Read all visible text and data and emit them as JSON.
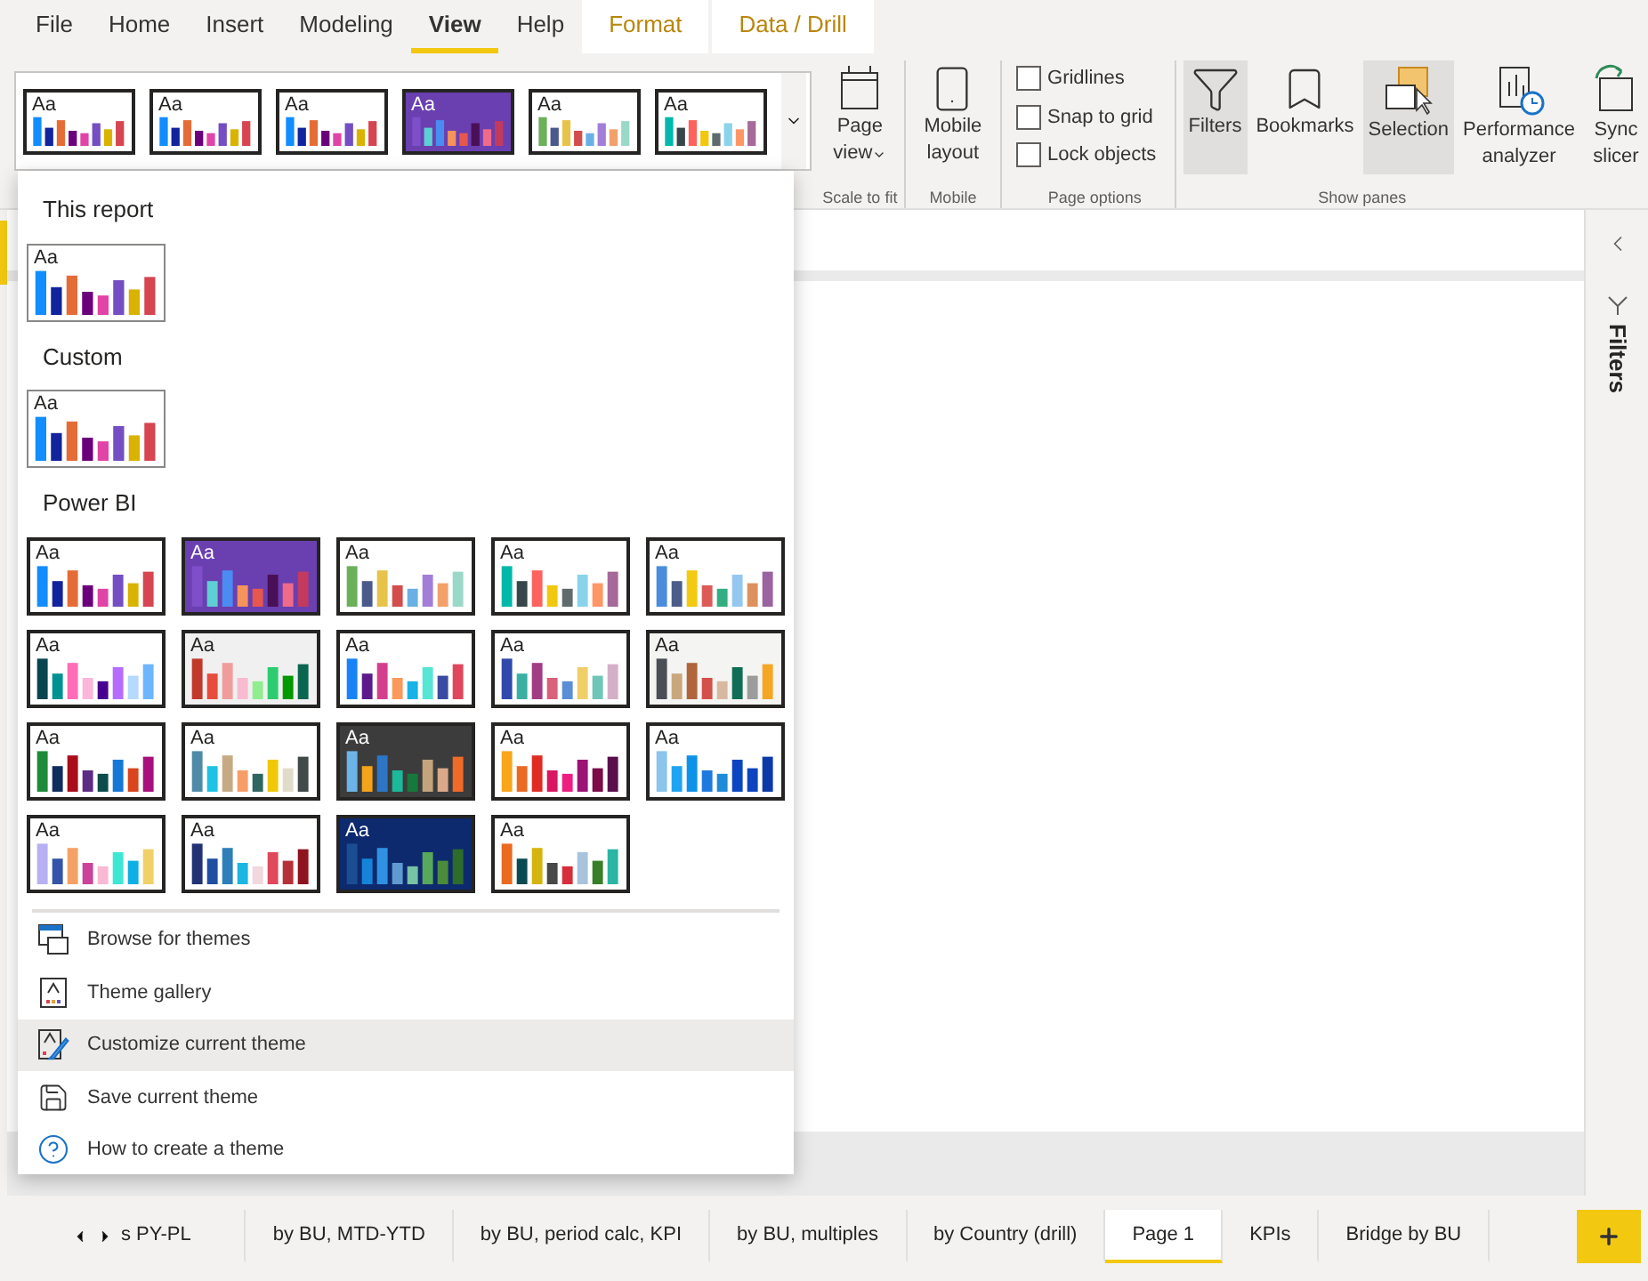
{
  "menu_tabs": [
    {
      "label": "File",
      "kind": "plain",
      "selected": false
    },
    {
      "label": "Home",
      "kind": "plain",
      "selected": false
    },
    {
      "label": "Insert",
      "kind": "plain",
      "selected": false
    },
    {
      "label": "Modeling",
      "kind": "plain",
      "selected": false
    },
    {
      "label": "View",
      "kind": "plain",
      "selected": true
    },
    {
      "label": "Help",
      "kind": "plain",
      "selected": false
    },
    {
      "label": "Format",
      "kind": "contextual",
      "selected": false
    },
    {
      "label": "Data / Drill",
      "kind": "contextual",
      "selected": false
    }
  ],
  "ribbon": {
    "theme_strip": [
      {
        "label": "Aa",
        "color": "#ffffff",
        "bars": [
          {
            "color": "#118dff"
          },
          {
            "color": "#12239e"
          },
          {
            "color": "#e66c37"
          },
          {
            "color": "#6b007b"
          },
          {
            "color": "#e044a7"
          },
          {
            "color": "#744ec2"
          },
          {
            "color": "#d9b300"
          },
          {
            "color": "#d64550"
          }
        ]
      },
      {
        "label": "Aa",
        "color": "#ffffff",
        "bars": [
          {
            "color": "#118dff"
          },
          {
            "color": "#12239e"
          },
          {
            "color": "#e66c37"
          },
          {
            "color": "#6b007b"
          },
          {
            "color": "#e044a7"
          },
          {
            "color": "#744ec2"
          },
          {
            "color": "#d9b300"
          },
          {
            "color": "#d64550"
          }
        ]
      },
      {
        "label": "Aa",
        "color": "#ffffff",
        "bars": [
          {
            "color": "#118dff"
          },
          {
            "color": "#12239e"
          },
          {
            "color": "#e66c37"
          },
          {
            "color": "#6b007b"
          },
          {
            "color": "#e044a7"
          },
          {
            "color": "#744ec2"
          },
          {
            "color": "#d9b300"
          },
          {
            "color": "#d64550"
          }
        ]
      },
      {
        "label": "Aa",
        "color": "#6a3fb0",
        "bars": [
          {
            "color": "#7e4fc8"
          },
          {
            "color": "#5ecfd3"
          },
          {
            "color": "#4a8cf2"
          },
          {
            "color": "#f4935a"
          },
          {
            "color": "#e8574d"
          },
          {
            "color": "#4a1057"
          },
          {
            "color": "#f06a8a"
          },
          {
            "color": "#c33a5f"
          }
        ]
      },
      {
        "label": "Aa",
        "color": "#ffffff",
        "bars": [
          {
            "color": "#6cb05a"
          },
          {
            "color": "#4b5a8a"
          },
          {
            "color": "#e8c34a"
          },
          {
            "color": "#d34d4d"
          },
          {
            "color": "#6ab0e4"
          },
          {
            "color": "#a37ed8"
          },
          {
            "color": "#f3a16b"
          },
          {
            "color": "#9ad9c8"
          }
        ]
      },
      {
        "label": "Aa",
        "color": "#ffffff",
        "bars": [
          {
            "color": "#01b8aa"
          },
          {
            "color": "#374649"
          },
          {
            "color": "#fd625e"
          },
          {
            "color": "#f2c80f"
          },
          {
            "color": "#5f6b6d"
          },
          {
            "color": "#8ad4eb"
          },
          {
            "color": "#fe9666"
          },
          {
            "color": "#a66999"
          }
        ]
      }
    ],
    "page_view": {
      "lines": [
        "Page",
        "view"
      ],
      "group": "Scale to fit"
    },
    "mobile_layout": {
      "lines": [
        "Mobile",
        "layout"
      ],
      "group": "Mobile"
    },
    "page_options": {
      "group": "Page options",
      "checkboxes": [
        {
          "label": "Gridlines",
          "checked": false
        },
        {
          "label": "Snap to grid",
          "checked": false
        },
        {
          "label": "Lock objects",
          "checked": false
        }
      ]
    },
    "show_panes": {
      "group": "Show panes",
      "buttons": [
        {
          "kind": "filters",
          "lines": [
            "Filters"
          ],
          "on": true
        },
        {
          "kind": "bookmarks",
          "lines": [
            "Bookmarks"
          ],
          "on": false
        },
        {
          "kind": "selection",
          "lines": [
            "Selection"
          ],
          "on": true
        },
        {
          "kind": "performance",
          "lines": [
            "Performance",
            "analyzer"
          ],
          "on": false
        },
        {
          "kind": "sync",
          "lines": [
            "Sync",
            "slicer"
          ],
          "on": false
        }
      ]
    }
  },
  "theme_menu": {
    "sections": [
      {
        "title": "This report",
        "themes": [
          {
            "label": "Aa",
            "color": "#ffffff",
            "bars": [
              {
                "color": "#118dff"
              },
              {
                "color": "#12239e"
              },
              {
                "color": "#e66c37"
              },
              {
                "color": "#6b007b"
              },
              {
                "color": "#e044a7"
              },
              {
                "color": "#744ec2"
              },
              {
                "color": "#d9b300"
              },
              {
                "color": "#d64550"
              }
            ]
          }
        ]
      },
      {
        "title": "Custom",
        "themes": [
          {
            "label": "Aa",
            "color": "#ffffff",
            "bars": [
              {
                "color": "#118dff"
              },
              {
                "color": "#12239e"
              },
              {
                "color": "#e66c37"
              },
              {
                "color": "#6b007b"
              },
              {
                "color": "#e044a7"
              },
              {
                "color": "#744ec2"
              },
              {
                "color": "#d9b300"
              },
              {
                "color": "#d64550"
              }
            ]
          }
        ]
      },
      {
        "title": "Power BI",
        "themes": [
          {
            "label": "Aa",
            "color": "#ffffff",
            "bars": [
              {
                "color": "#118dff"
              },
              {
                "color": "#12239e"
              },
              {
                "color": "#e66c37"
              },
              {
                "color": "#6b007b"
              },
              {
                "color": "#e044a7"
              },
              {
                "color": "#744ec2"
              },
              {
                "color": "#d9b300"
              },
              {
                "color": "#d64550"
              }
            ]
          },
          {
            "label": "Aa",
            "color": "#6a3fb0",
            "bars": [
              {
                "color": "#7e4fc8"
              },
              {
                "color": "#5ecfd3"
              },
              {
                "color": "#4a8cf2"
              },
              {
                "color": "#f4935a"
              },
              {
                "color": "#e8574d"
              },
              {
                "color": "#4a1057"
              },
              {
                "color": "#f06a8a"
              },
              {
                "color": "#c33a5f"
              }
            ]
          },
          {
            "label": "Aa",
            "color": "#ffffff",
            "bars": [
              {
                "color": "#6cb05a"
              },
              {
                "color": "#4b5a8a"
              },
              {
                "color": "#e8c34a"
              },
              {
                "color": "#d34d4d"
              },
              {
                "color": "#6ab0e4"
              },
              {
                "color": "#a37ed8"
              },
              {
                "color": "#f3a16b"
              },
              {
                "color": "#9ad9c8"
              }
            ]
          },
          {
            "label": "Aa",
            "color": "#ffffff",
            "bars": [
              {
                "color": "#01b8aa"
              },
              {
                "color": "#374649"
              },
              {
                "color": "#fd625e"
              },
              {
                "color": "#f2c80f"
              },
              {
                "color": "#5f6b6d"
              },
              {
                "color": "#8ad4eb"
              },
              {
                "color": "#fe9666"
              },
              {
                "color": "#a66999"
              }
            ]
          },
          {
            "label": "Aa",
            "color": "#ffffff",
            "bars": [
              {
                "color": "#4a8ddc"
              },
              {
                "color": "#4c5d8a"
              },
              {
                "color": "#f3c911"
              },
              {
                "color": "#dc5b57"
              },
              {
                "color": "#33ae81"
              },
              {
                "color": "#95c8f0"
              },
              {
                "color": "#dd915f"
              },
              {
                "color": "#9a64a0"
              }
            ]
          },
          {
            "label": "Aa",
            "color": "#ffffff",
            "bars": [
              {
                "color": "#074650"
              },
              {
                "color": "#009292"
              },
              {
                "color": "#fe6db6"
              },
              {
                "color": "#feb5da"
              },
              {
                "color": "#480091"
              },
              {
                "color": "#b66dff"
              },
              {
                "color": "#b5dafe"
              },
              {
                "color": "#6db6ff"
              }
            ]
          },
          {
            "label": "Aa",
            "color": "#f0f0f0",
            "bars": [
              {
                "color": "#c0392b"
              },
              {
                "color": "#e74c3c"
              },
              {
                "color": "#f19c9c"
              },
              {
                "color": "#f8bbd0"
              },
              {
                "color": "#90ee90"
              },
              {
                "color": "#2ecc71"
              },
              {
                "color": "#009900"
              },
              {
                "color": "#0b6650"
              }
            ]
          },
          {
            "label": "Aa",
            "color": "#ffffff",
            "bars": [
              {
                "color": "#1883f6"
              },
              {
                "color": "#5c1a8a"
              },
              {
                "color": "#d43f8d"
              },
              {
                "color": "#f99a5b"
              },
              {
                "color": "#17b2e6"
              },
              {
                "color": "#55e6d6"
              },
              {
                "color": "#3b4ba3"
              },
              {
                "color": "#e0475d"
              }
            ]
          },
          {
            "label": "Aa",
            "color": "#ffffff",
            "bars": [
              {
                "color": "#3049ad"
              },
              {
                "color": "#3ab0a3"
              },
              {
                "color": "#a23c83"
              },
              {
                "color": "#d9617a"
              },
              {
                "color": "#5b8ed6"
              },
              {
                "color": "#f0cf68"
              },
              {
                "color": "#6fc6b7"
              },
              {
                "color": "#d4afc8"
              }
            ]
          },
          {
            "label": "Aa",
            "color": "#f4f4f2",
            "bars": [
              {
                "color": "#4a4f55"
              },
              {
                "color": "#c9a77c"
              },
              {
                "color": "#b0653c"
              },
              {
                "color": "#d3514a"
              },
              {
                "color": "#d9b8a0"
              },
              {
                "color": "#0f6e55"
              },
              {
                "color": "#9c9c9c"
              },
              {
                "color": "#f5a623"
              }
            ]
          },
          {
            "label": "Aa",
            "color": "#ffffff",
            "bars": [
              {
                "color": "#1e8b3a"
              },
              {
                "color": "#0f2d5c"
              },
              {
                "color": "#a90d19"
              },
              {
                "color": "#5d2b84"
              },
              {
                "color": "#0d4c4c"
              },
              {
                "color": "#1578d6"
              },
              {
                "color": "#d9451e"
              },
              {
                "color": "#a80e7e"
              }
            ]
          },
          {
            "label": "Aa",
            "color": "#ffffff",
            "bars": [
              {
                "color": "#4f8ba8"
              },
              {
                "color": "#1ec3e3"
              },
              {
                "color": "#c6aa83"
              },
              {
                "color": "#f79e68"
              },
              {
                "color": "#2f6660"
              },
              {
                "color": "#f0c808"
              },
              {
                "color": "#e0dcca"
              },
              {
                "color": "#3f4a49"
              }
            ]
          },
          {
            "label": "Aa",
            "color": "#3c3c3c",
            "bars": [
              {
                "color": "#6cb4e8"
              },
              {
                "color": "#f4a31b"
              },
              {
                "color": "#2d76c6"
              },
              {
                "color": "#1bb89a"
              },
              {
                "color": "#17783d"
              },
              {
                "color": "#c4a47c"
              },
              {
                "color": "#d9a98a"
              },
              {
                "color": "#f06a28"
              }
            ]
          },
          {
            "label": "Aa",
            "color": "#ffffff",
            "bars": [
              {
                "color": "#f9a61a"
              },
              {
                "color": "#eb6a22"
              },
              {
                "color": "#e02d24"
              },
              {
                "color": "#d81760"
              },
              {
                "color": "#ef1d82"
              },
              {
                "color": "#9c1276"
              },
              {
                "color": "#7c0b46"
              },
              {
                "color": "#5b0e4c"
              }
            ]
          },
          {
            "label": "Aa",
            "color": "#ffffff",
            "bars": [
              {
                "color": "#8cc5ec"
              },
              {
                "color": "#1ea4f2"
              },
              {
                "color": "#0d92ea"
              },
              {
                "color": "#1f7ae0"
              },
              {
                "color": "#1d8bd7"
              },
              {
                "color": "#0a46c2"
              },
              {
                "color": "#0c44c0"
              },
              {
                "color": "#0b3aa8"
              }
            ]
          },
          {
            "label": "Aa",
            "color": "#ffffff",
            "bars": [
              {
                "color": "#b7b0f2"
              },
              {
                "color": "#3354a8"
              },
              {
                "color": "#f5a165"
              },
              {
                "color": "#c9449a"
              },
              {
                "color": "#f9b8d4"
              },
              {
                "color": "#3de7d4"
              },
              {
                "color": "#0db0e4"
              },
              {
                "color": "#f0d067"
              }
            ]
          },
          {
            "label": "Aa",
            "color": "#ffffff",
            "bars": [
              {
                "color": "#223275"
              },
              {
                "color": "#1e4fa1"
              },
              {
                "color": "#2e7fb9"
              },
              {
                "color": "#1bb6e2"
              },
              {
                "color": "#f2d7dd"
              },
              {
                "color": "#e0485b"
              },
              {
                "color": "#b5313a"
              },
              {
                "color": "#8f121f"
              }
            ]
          },
          {
            "label": "Aa",
            "color": "#0d2a6e",
            "bars": [
              {
                "color": "#1b4d93"
              },
              {
                "color": "#1584d8"
              },
              {
                "color": "#2f91e2"
              },
              {
                "color": "#5f9bd1"
              },
              {
                "color": "#78c2a5"
              },
              {
                "color": "#58a85c"
              },
              {
                "color": "#4b8c3a"
              },
              {
                "color": "#2d6c2b"
              }
            ]
          },
          {
            "label": "Aa",
            "color": "#ffffff",
            "bars": [
              {
                "color": "#ea6a1f"
              },
              {
                "color": "#0a4b51"
              },
              {
                "color": "#d6b40e"
              },
              {
                "color": "#484848"
              },
              {
                "color": "#d62f3b"
              },
              {
                "color": "#a9c3dc"
              },
              {
                "color": "#387f2a"
              },
              {
                "color": "#2bb5a3"
              }
            ]
          }
        ]
      }
    ],
    "actions": [
      {
        "kind": "browse",
        "label": "Browse for themes",
        "hovered": false
      },
      {
        "kind": "gallery",
        "label": "Theme gallery",
        "hovered": false
      },
      {
        "kind": "customize",
        "label": "Customize current theme",
        "hovered": true
      },
      {
        "kind": "save",
        "label": "Save current theme",
        "hovered": false
      },
      {
        "kind": "help",
        "label": "How to create a theme",
        "hovered": false
      }
    ]
  },
  "filters_pane": {
    "label": "Filters"
  },
  "page_tabs": [
    {
      "label": "s PY-PL",
      "selected": false
    },
    {
      "label": "by BU, MTD-YTD",
      "selected": false
    },
    {
      "label": "by BU, period calc, KPI",
      "selected": false
    },
    {
      "label": "by BU, multiples",
      "selected": false
    },
    {
      "label": "by Country (drill)",
      "selected": false
    },
    {
      "label": "Page 1",
      "selected": true
    },
    {
      "label": "KPIs",
      "selected": false
    },
    {
      "label": "Bridge by BU",
      "selected": false
    }
  ]
}
